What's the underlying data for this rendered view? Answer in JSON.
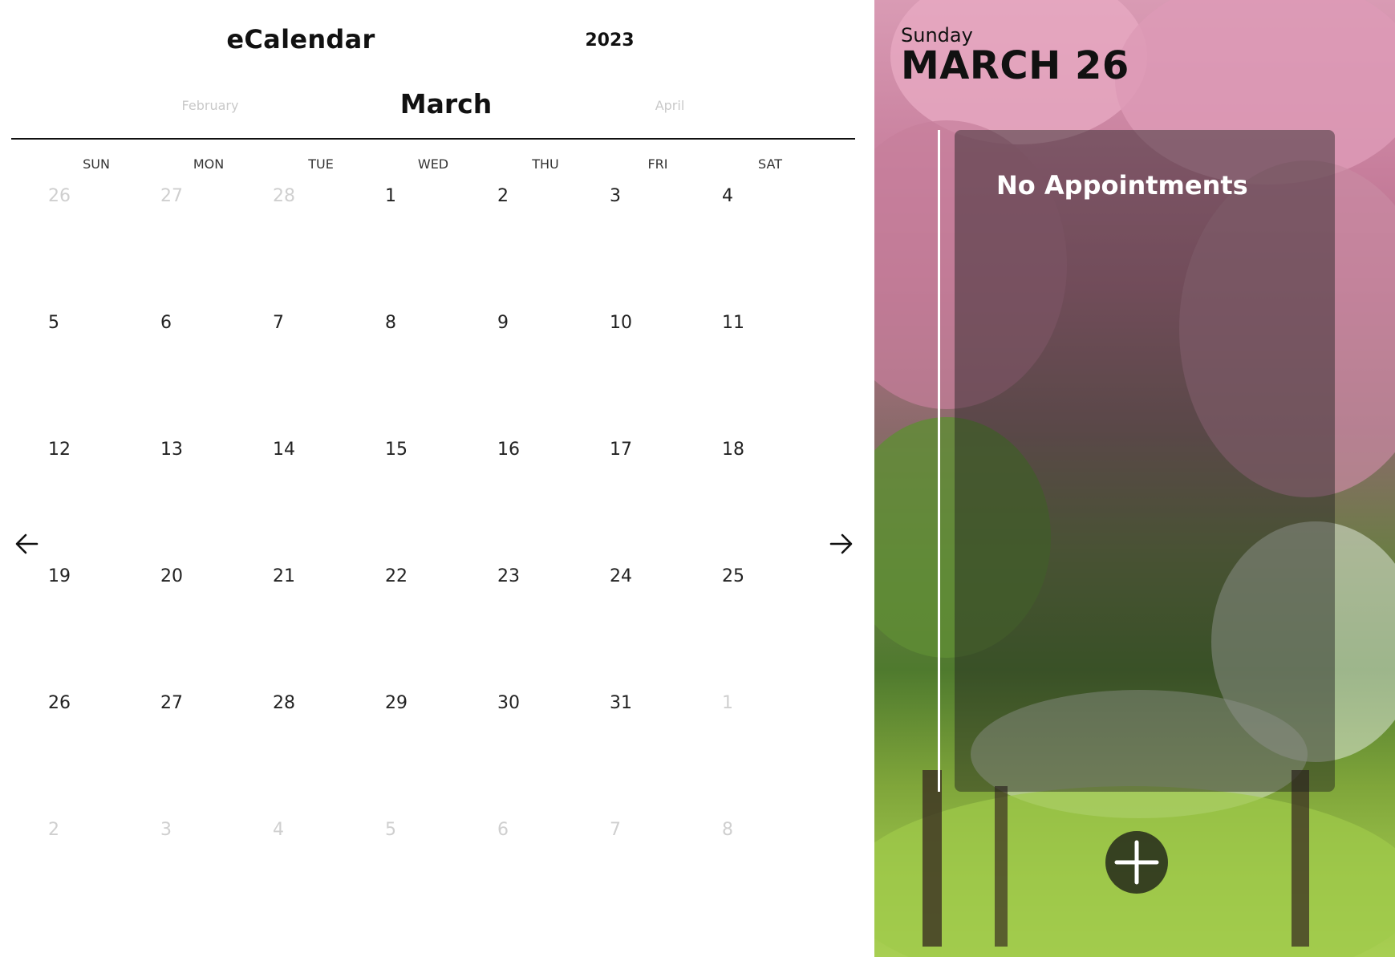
{
  "header": {
    "app_title": "eCalendar",
    "year": "2023"
  },
  "months": {
    "previous": "February",
    "current": "March",
    "next": "April"
  },
  "weekdays": [
    "SUN",
    "MON",
    "TUE",
    "WED",
    "THU",
    "FRI",
    "SAT"
  ],
  "weeks": [
    [
      {
        "d": "26",
        "muted": true
      },
      {
        "d": "27",
        "muted": true
      },
      {
        "d": "28",
        "muted": true
      },
      {
        "d": "1"
      },
      {
        "d": "2"
      },
      {
        "d": "3"
      },
      {
        "d": "4"
      }
    ],
    [
      {
        "d": "5"
      },
      {
        "d": "6"
      },
      {
        "d": "7"
      },
      {
        "d": "8"
      },
      {
        "d": "9"
      },
      {
        "d": "10"
      },
      {
        "d": "11"
      }
    ],
    [
      {
        "d": "12"
      },
      {
        "d": "13"
      },
      {
        "d": "14"
      },
      {
        "d": "15"
      },
      {
        "d": "16"
      },
      {
        "d": "17"
      },
      {
        "d": "18"
      }
    ],
    [
      {
        "d": "19"
      },
      {
        "d": "20"
      },
      {
        "d": "21"
      },
      {
        "d": "22"
      },
      {
        "d": "23"
      },
      {
        "d": "24"
      },
      {
        "d": "25"
      }
    ],
    [
      {
        "d": "26"
      },
      {
        "d": "27"
      },
      {
        "d": "28"
      },
      {
        "d": "29"
      },
      {
        "d": "30"
      },
      {
        "d": "31"
      },
      {
        "d": "1",
        "muted": true
      }
    ],
    [
      {
        "d": "2",
        "muted": true
      },
      {
        "d": "3",
        "muted": true
      },
      {
        "d": "4",
        "muted": true
      },
      {
        "d": "5",
        "muted": true
      },
      {
        "d": "6",
        "muted": true
      },
      {
        "d": "7",
        "muted": true
      },
      {
        "d": "8",
        "muted": true
      }
    ]
  ],
  "nav": {
    "prev_icon": "arrow-left-icon",
    "next_icon": "arrow-right-icon"
  },
  "selected_day": {
    "weekday": "Sunday",
    "date": "MARCH 26"
  },
  "appointments": {
    "empty_message": "No Appointments"
  },
  "add_button": {
    "icon": "plus-icon"
  },
  "colors": {
    "muted_day": "#cfcfcf",
    "overlay": "#1e1e1e",
    "accent_text": "#ffffff"
  }
}
